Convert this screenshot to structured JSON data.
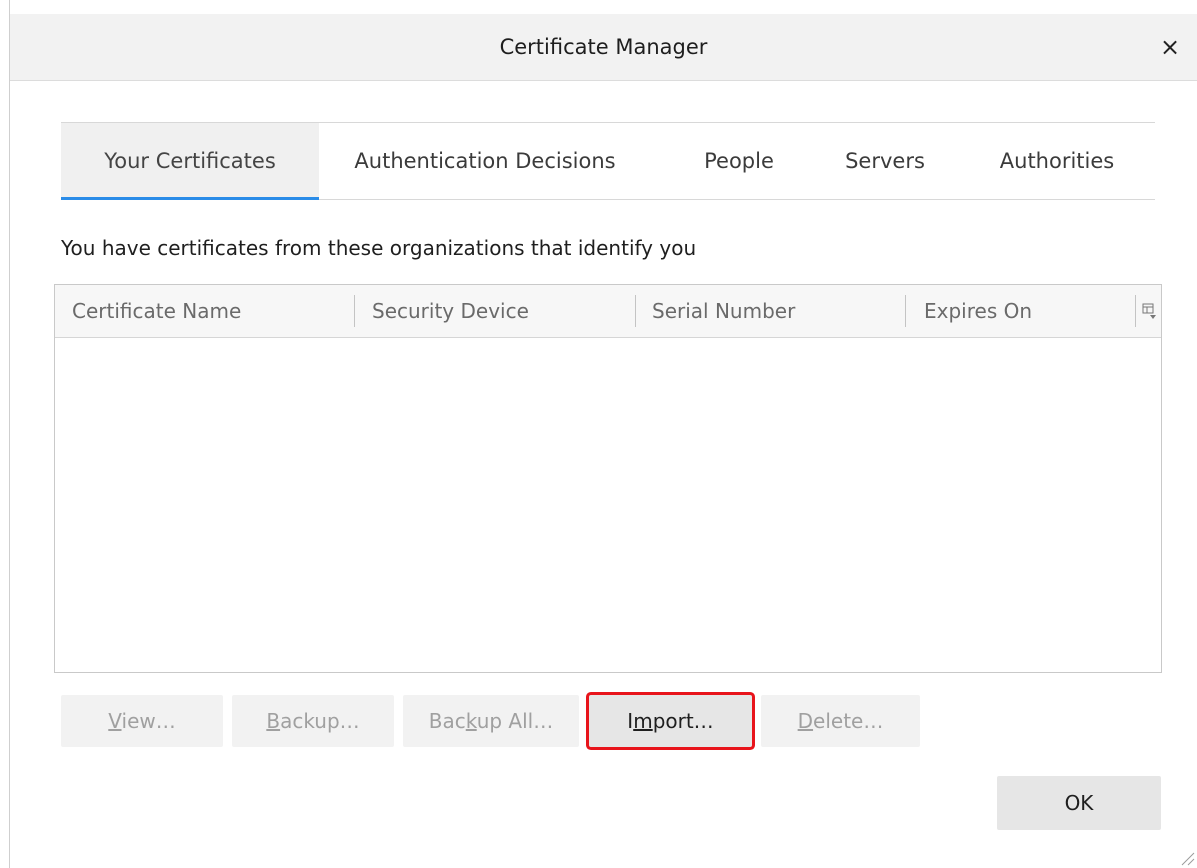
{
  "window": {
    "title": "Certificate Manager",
    "close_glyph": "×"
  },
  "tabs": [
    {
      "label": "Your Certificates",
      "selected": true
    },
    {
      "label": "Authentication Decisions",
      "selected": false
    },
    {
      "label": "People",
      "selected": false
    },
    {
      "label": "Servers",
      "selected": false
    },
    {
      "label": "Authorities",
      "selected": false
    }
  ],
  "description": "You have certificates from these organizations that identify you",
  "table": {
    "columns": [
      "Certificate Name",
      "Security Device",
      "Serial Number",
      "Expires On"
    ],
    "rows": []
  },
  "buttons": {
    "view": {
      "pre": "",
      "access": "V",
      "post": "iew…",
      "enabled": false
    },
    "backup": {
      "pre": "",
      "access": "B",
      "post": "ackup…",
      "enabled": false
    },
    "backup_all": {
      "pre": "Bac",
      "access": "k",
      "post": "up All…",
      "enabled": false
    },
    "import": {
      "pre": "I",
      "access": "m",
      "post": "port…",
      "enabled": true,
      "highlighted": true
    },
    "delete": {
      "pre": "",
      "access": "D",
      "post": "elete…",
      "enabled": false
    },
    "ok": "OK"
  },
  "colors": {
    "accent": "#2a8ce8",
    "highlight_border": "#e8141b"
  },
  "icons": {
    "close": "close-icon",
    "column_picker": "column-picker-icon",
    "resize": "resize-grip-icon"
  }
}
